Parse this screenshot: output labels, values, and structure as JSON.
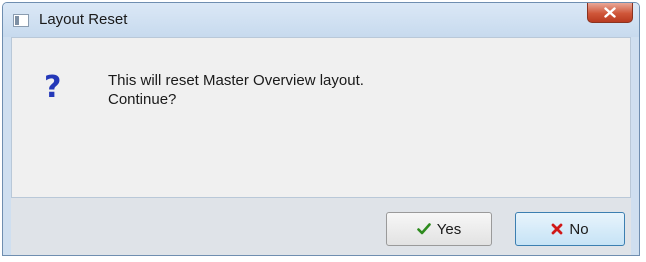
{
  "window": {
    "title": "Layout Reset",
    "title_icon": "app-window-icon",
    "close_icon": "close-icon"
  },
  "dialog": {
    "icon": "question-icon",
    "icon_glyph": "?",
    "icon_color": "#2438b8",
    "message_line1": "This will reset Master Overview layout.",
    "message_line2": "Continue?"
  },
  "buttons": {
    "yes_label": "Yes",
    "yes_icon": "checkmark-icon",
    "yes_icon_color": "#2e8b1e",
    "no_label": "No",
    "no_icon": "x-icon",
    "no_icon_color": "#d01818"
  }
}
